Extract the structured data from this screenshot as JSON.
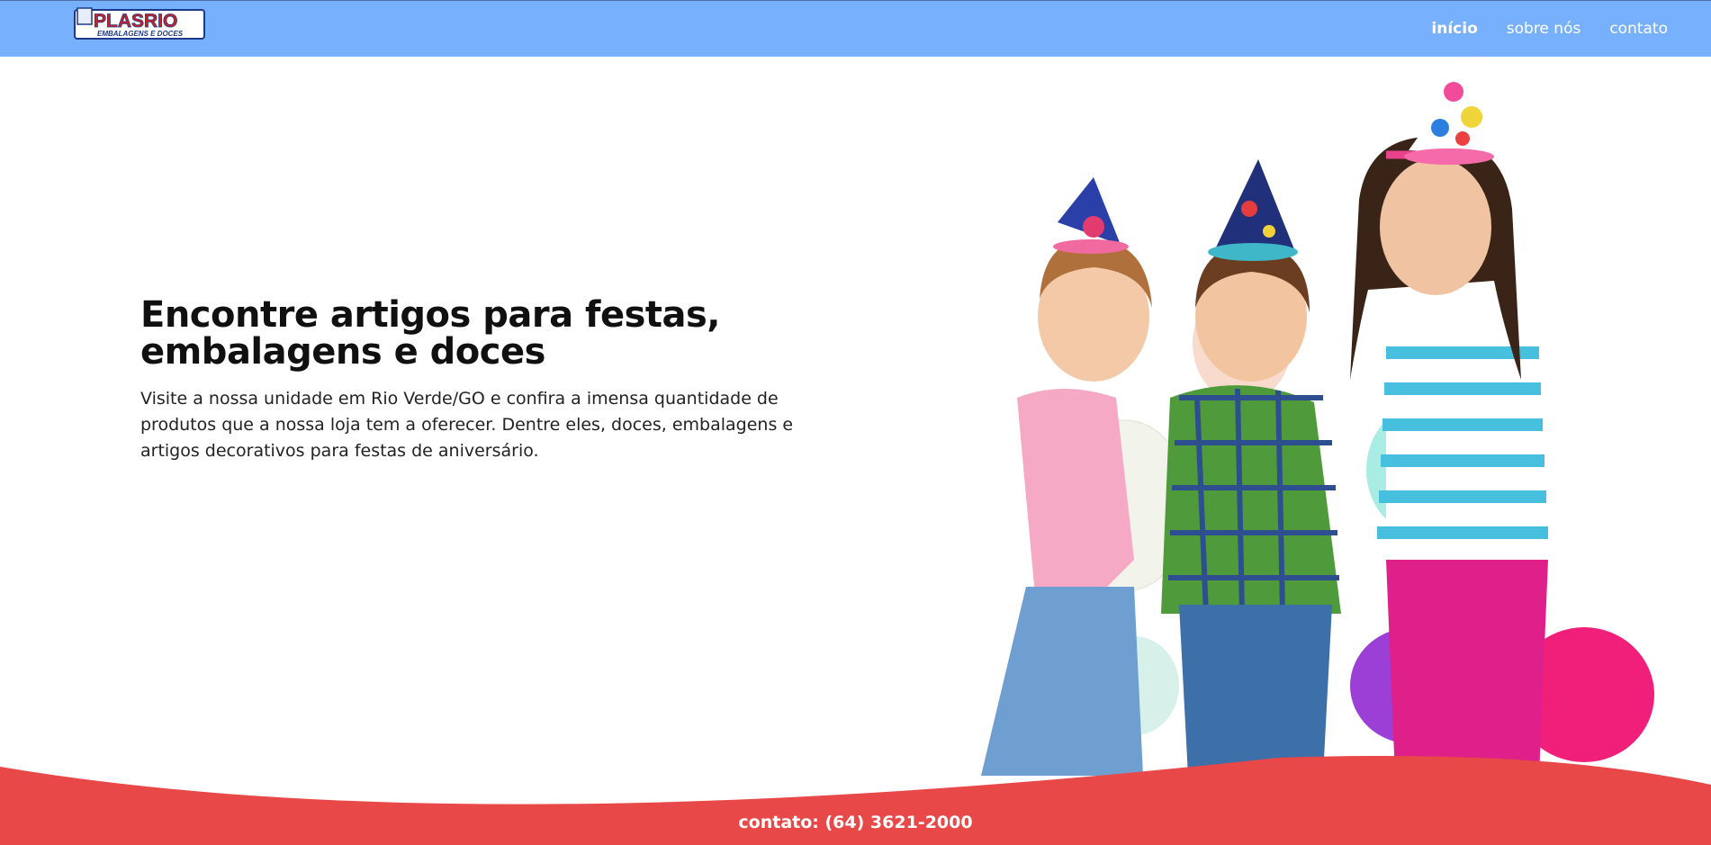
{
  "header": {
    "logo_text_main": "PLASRIO",
    "logo_text_sub": "EMBALAGENS E DOCES",
    "nav": [
      {
        "label": "início"
      },
      {
        "label": "sobre nós"
      },
      {
        "label": "contato"
      }
    ]
  },
  "hero": {
    "title": "Encontre artigos para festas, embalagens e doces",
    "text": "Visite a nossa unidade em Rio Verde/GO e confira a imensa quantidade de produtos que a nossa loja tem a oferecer. Dentre eles, doces, embalagens e artigos decorativos para festas de aniversário."
  },
  "footer": {
    "contact": "contato: (64) 3621-2000"
  },
  "colors": {
    "header_bg": "#77b0fc",
    "wave": "#e84848",
    "text": "#101010"
  }
}
